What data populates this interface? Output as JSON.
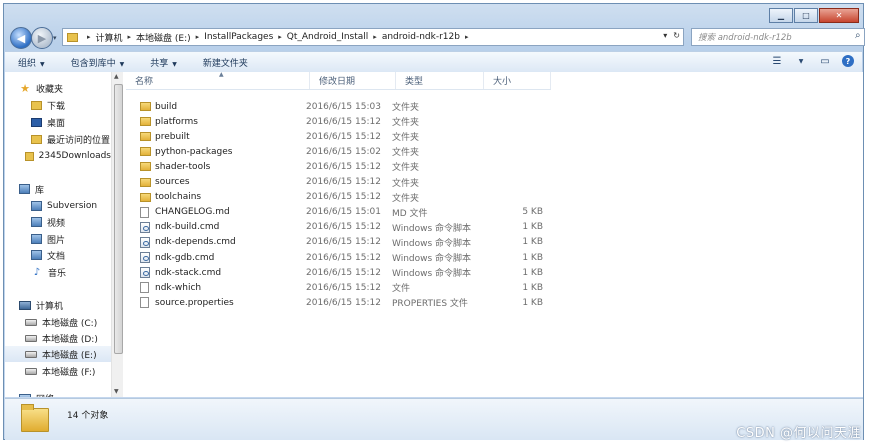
{
  "window": {
    "minimize": "▁",
    "maximize": "□",
    "close": "✕"
  },
  "nav": {
    "back_icon": "arrow-left",
    "forward_icon": "arrow-right",
    "dropdown": "▾"
  },
  "address": {
    "breadcrumbs": [
      "计算机",
      "本地磁盘 (E:)",
      "InstallPackages",
      "Qt_Android_Install",
      "android-ndk-r12b"
    ],
    "dropdown_glyph": "▾",
    "refresh_glyph": "↻"
  },
  "search": {
    "placeholder": "搜索 android-ndk-r12b"
  },
  "toolbar": {
    "organize": "组织",
    "include_in_library": "包含到库中",
    "share": "共享",
    "new_folder": "新建文件夹"
  },
  "sidebar": {
    "favorites": "收藏夹",
    "fav_items": [
      "下载",
      "桌面",
      "最近访问的位置",
      "2345Downloads"
    ],
    "libraries": "库",
    "lib_items": [
      "Subversion",
      "视频",
      "图片",
      "文档",
      "音乐"
    ],
    "computer": "计算机",
    "drives": [
      "本地磁盘 (C:)",
      "本地磁盘 (D:)",
      "本地磁盘 (E:)",
      "本地磁盘 (F:)"
    ],
    "network": "网络",
    "selected": "本地磁盘 (E:)"
  },
  "columns": {
    "name": "名称",
    "date": "修改日期",
    "type": "类型",
    "size": "大小"
  },
  "files": [
    {
      "name": "build",
      "date": "2016/6/15 15:03",
      "type": "文件夹",
      "size": "",
      "kind": "folder"
    },
    {
      "name": "platforms",
      "date": "2016/6/15 15:12",
      "type": "文件夹",
      "size": "",
      "kind": "folder"
    },
    {
      "name": "prebuilt",
      "date": "2016/6/15 15:12",
      "type": "文件夹",
      "size": "",
      "kind": "folder"
    },
    {
      "name": "python-packages",
      "date": "2016/6/15 15:02",
      "type": "文件夹",
      "size": "",
      "kind": "folder"
    },
    {
      "name": "shader-tools",
      "date": "2016/6/15 15:12",
      "type": "文件夹",
      "size": "",
      "kind": "folder"
    },
    {
      "name": "sources",
      "date": "2016/6/15 15:12",
      "type": "文件夹",
      "size": "",
      "kind": "folder"
    },
    {
      "name": "toolchains",
      "date": "2016/6/15 15:12",
      "type": "文件夹",
      "size": "",
      "kind": "folder"
    },
    {
      "name": "CHANGELOG.md",
      "date": "2016/6/15 15:01",
      "type": "MD 文件",
      "size": "5 KB",
      "kind": "file"
    },
    {
      "name": "ndk-build.cmd",
      "date": "2016/6/15 15:12",
      "type": "Windows 命令脚本",
      "size": "1 KB",
      "kind": "cmd"
    },
    {
      "name": "ndk-depends.cmd",
      "date": "2016/6/15 15:12",
      "type": "Windows 命令脚本",
      "size": "1 KB",
      "kind": "cmd"
    },
    {
      "name": "ndk-gdb.cmd",
      "date": "2016/6/15 15:12",
      "type": "Windows 命令脚本",
      "size": "1 KB",
      "kind": "cmd"
    },
    {
      "name": "ndk-stack.cmd",
      "date": "2016/6/15 15:12",
      "type": "Windows 命令脚本",
      "size": "1 KB",
      "kind": "cmd"
    },
    {
      "name": "ndk-which",
      "date": "2016/6/15 15:12",
      "type": "文件",
      "size": "1 KB",
      "kind": "file"
    },
    {
      "name": "source.properties",
      "date": "2016/6/15 15:12",
      "type": "PROPERTIES 文件",
      "size": "1 KB",
      "kind": "file"
    }
  ],
  "status": {
    "count": "14 个对象"
  },
  "watermark": "CSDN @何以问天涯"
}
